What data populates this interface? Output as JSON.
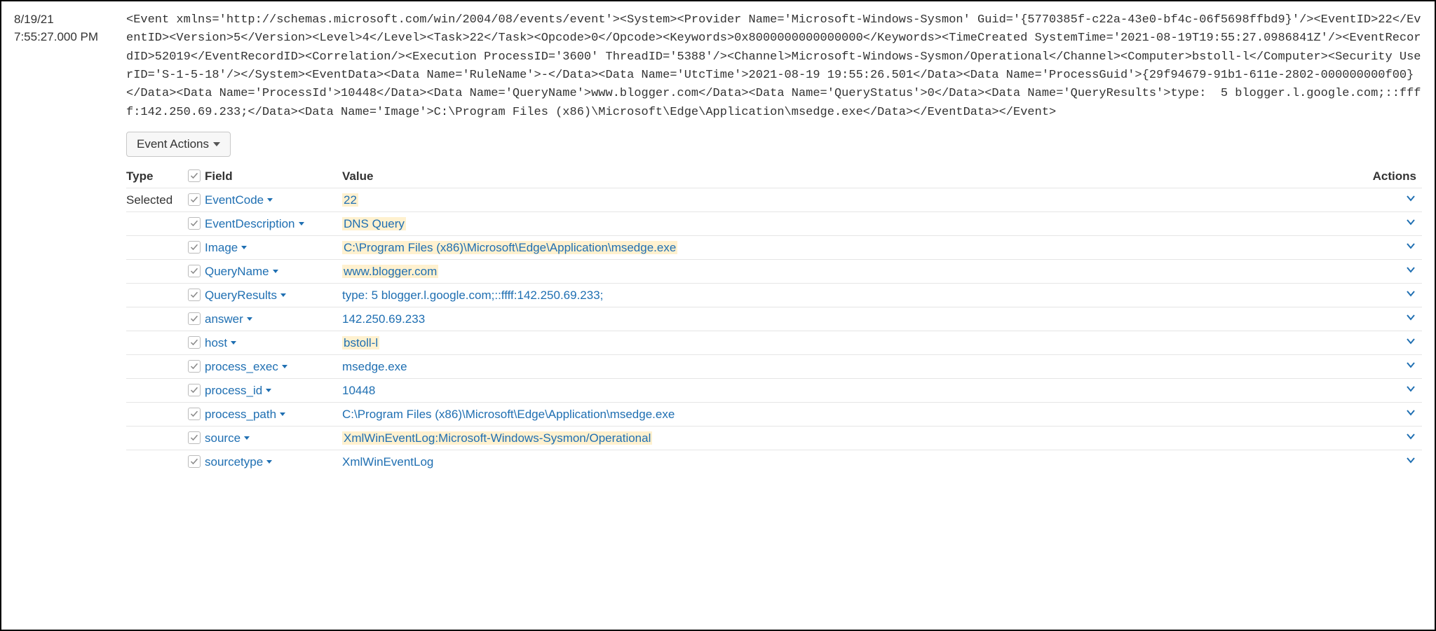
{
  "timestamp": {
    "date": "8/19/21",
    "time": "7:55:27.000 PM"
  },
  "raw_event": "<Event xmlns='http://schemas.microsoft.com/win/2004/08/events/event'><System><Provider Name='Microsoft-Windows-Sysmon' Guid='{5770385f-c22a-43e0-bf4c-06f5698ffbd9}'/><EventID>22</EventID><Version>5</Version><Level>4</Level><Task>22</Task><Opcode>0</Opcode><Keywords>0x8000000000000000</Keywords><TimeCreated SystemTime='2021-08-19T19:55:27.0986841Z'/><EventRecordID>52019</EventRecordID><Correlation/><Execution ProcessID='3600' ThreadID='5388'/><Channel>Microsoft-Windows-Sysmon/Operational</Channel><Computer>bstoll-l</Computer><Security UserID='S-1-5-18'/></System><EventData><Data Name='RuleName'>-</Data><Data Name='UtcTime'>2021-08-19 19:55:26.501</Data><Data Name='ProcessGuid'>{29f94679-91b1-611e-2802-000000000f00}</Data><Data Name='ProcessId'>10448</Data><Data Name='QueryName'>www.blogger.com</Data><Data Name='QueryStatus'>0</Data><Data Name='QueryResults'>type:  5 blogger.l.google.com;::ffff:142.250.69.233;</Data><Data Name='Image'>C:\\Program Files (x86)\\Microsoft\\Edge\\Application\\msedge.exe</Data></EventData></Event>",
  "event_actions_label": "Event Actions",
  "headers": {
    "type": "Type",
    "field": "Field",
    "value": "Value",
    "actions": "Actions"
  },
  "selected_label": "Selected",
  "fields": [
    {
      "name": "EventCode",
      "value": "22",
      "highlight": true
    },
    {
      "name": "EventDescription",
      "value": "DNS Query",
      "highlight": true
    },
    {
      "name": "Image",
      "value": "C:\\Program Files (x86)\\Microsoft\\Edge\\Application\\msedge.exe",
      "highlight": true
    },
    {
      "name": "QueryName",
      "value": "www.blogger.com",
      "highlight": true
    },
    {
      "name": "QueryResults",
      "value": "type: 5 blogger.l.google.com;::ffff:142.250.69.233;",
      "highlight": false
    },
    {
      "name": "answer",
      "value": "142.250.69.233",
      "highlight": false
    },
    {
      "name": "host",
      "value": "bstoll-l",
      "highlight": true
    },
    {
      "name": "process_exec",
      "value": "msedge.exe",
      "highlight": false
    },
    {
      "name": "process_id",
      "value": "10448",
      "highlight": false
    },
    {
      "name": "process_path",
      "value": "C:\\Program Files (x86)\\Microsoft\\Edge\\Application\\msedge.exe",
      "highlight": false
    },
    {
      "name": "source",
      "value": "XmlWinEventLog:Microsoft-Windows-Sysmon/Operational",
      "highlight": true
    },
    {
      "name": "sourcetype",
      "value": "XmlWinEventLog",
      "highlight": false
    }
  ]
}
